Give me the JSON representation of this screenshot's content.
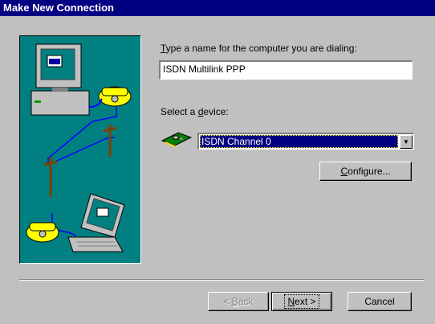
{
  "window": {
    "title": "Make New Connection"
  },
  "name_prompt": {
    "accel": "T",
    "rest": "ype a name for the computer you are dialing:"
  },
  "name_input": {
    "value": "ISDN Multilink PPP"
  },
  "device_prompt": {
    "before": "Select a ",
    "accel": "d",
    "rest": "evice:"
  },
  "device_select": {
    "value": "ISDN Channel 0"
  },
  "configure_button": {
    "accel": "C",
    "rest": "onfigure..."
  },
  "back_button": {
    "prefix": "< ",
    "accel": "B",
    "rest": "ack"
  },
  "next_button": {
    "accel": "N",
    "rest": "ext >"
  },
  "cancel_button": {
    "label": "Cancel"
  },
  "colors": {
    "title_bar": "#000080",
    "illustration_bg": "#008080",
    "face": "#c0c0c0"
  }
}
